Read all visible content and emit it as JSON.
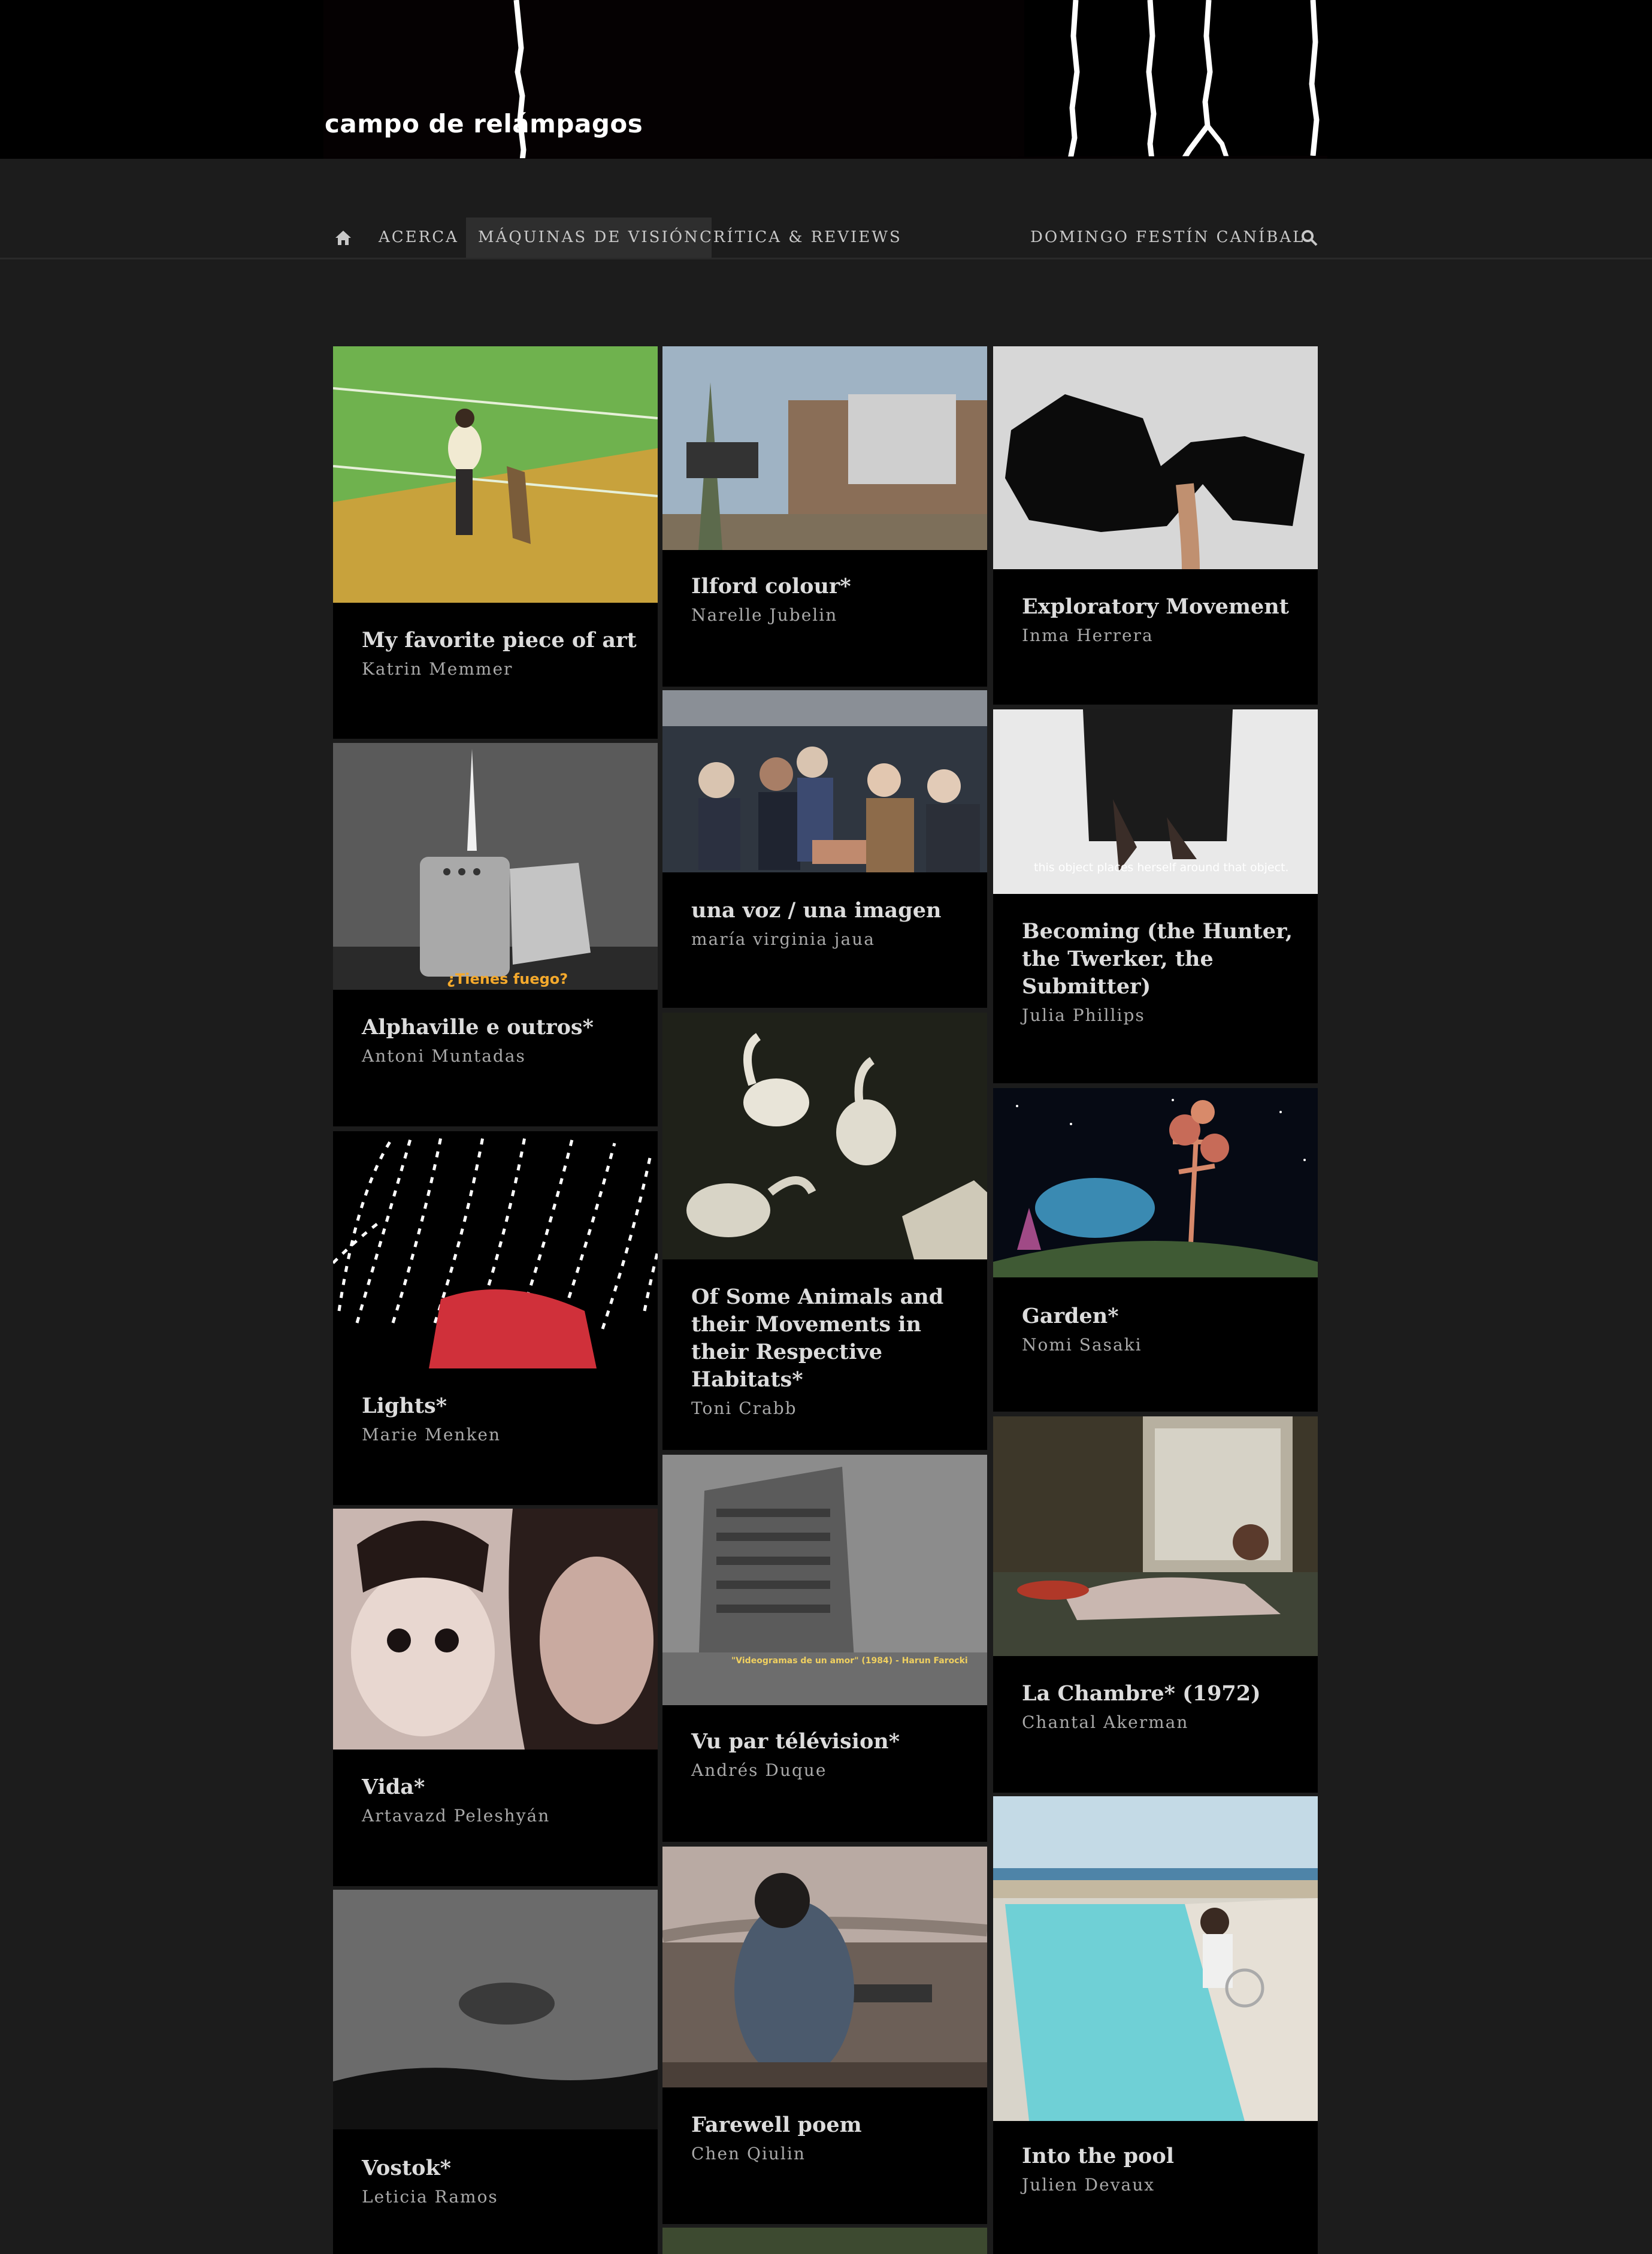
{
  "site": {
    "logo": "campo de relámpagos"
  },
  "nav": {
    "home_icon": "home-icon",
    "items": [
      "ACERCA",
      "MÁQUINAS DE VISIÓN",
      "CRÍTICA & REVIEWS"
    ],
    "right_item": "DOMINGO FESTÍN CANÍBAL",
    "search_icon": "search-icon",
    "active": "MÁQUINAS DE VISIÓN"
  },
  "cards": [
    {
      "title": "My favorite piece of art",
      "author": "Katrin Memmer"
    },
    {
      "title": "Alphaville e outros*",
      "author": "Antoni Muntadas",
      "subtitle_in_image": "¿Tienes fuego?"
    },
    {
      "title": "Lights*",
      "author": "Marie Menken"
    },
    {
      "title": "Vida*",
      "author": "Artavazd Peleshyán"
    },
    {
      "title": "Vostok*",
      "author": "Leticia Ramos"
    },
    {
      "title": "Ilford colour*",
      "author": "Narelle Jubelin"
    },
    {
      "title": "una voz / una imagen",
      "author": "maría virginia jaua"
    },
    {
      "title": "Of Some Animals and their Movements in their Respective Habitats*",
      "author": "Toni Crabb"
    },
    {
      "title": "Vu par télévision*",
      "author": "Andrés Duque",
      "subtitle_in_image": "\"Videogramas de un amor\" (1984) - Harun Farocki"
    },
    {
      "title": "Farewell poem",
      "author": "Chen Qiulin"
    },
    {
      "title": "Exploratory Movement",
      "author": "Inma Herrera"
    },
    {
      "title": "Becoming (the Hunter, the Twerker, the Submitter)",
      "author": "Julia Phillips",
      "subtitle_in_image": "this object places herself around that object."
    },
    {
      "title": "Garden*",
      "author": "Nomi Sasaki"
    },
    {
      "title": "La Chambre* (1972)",
      "author": "Chantal Akerman"
    },
    {
      "title": "Into the pool",
      "author": "Julien Devaux"
    }
  ],
  "colors": {
    "page_bg": "#1c1c1c",
    "card_bg": "#000000",
    "header_bg": "#000000",
    "nav_active_bg": "#2e2e2e"
  }
}
